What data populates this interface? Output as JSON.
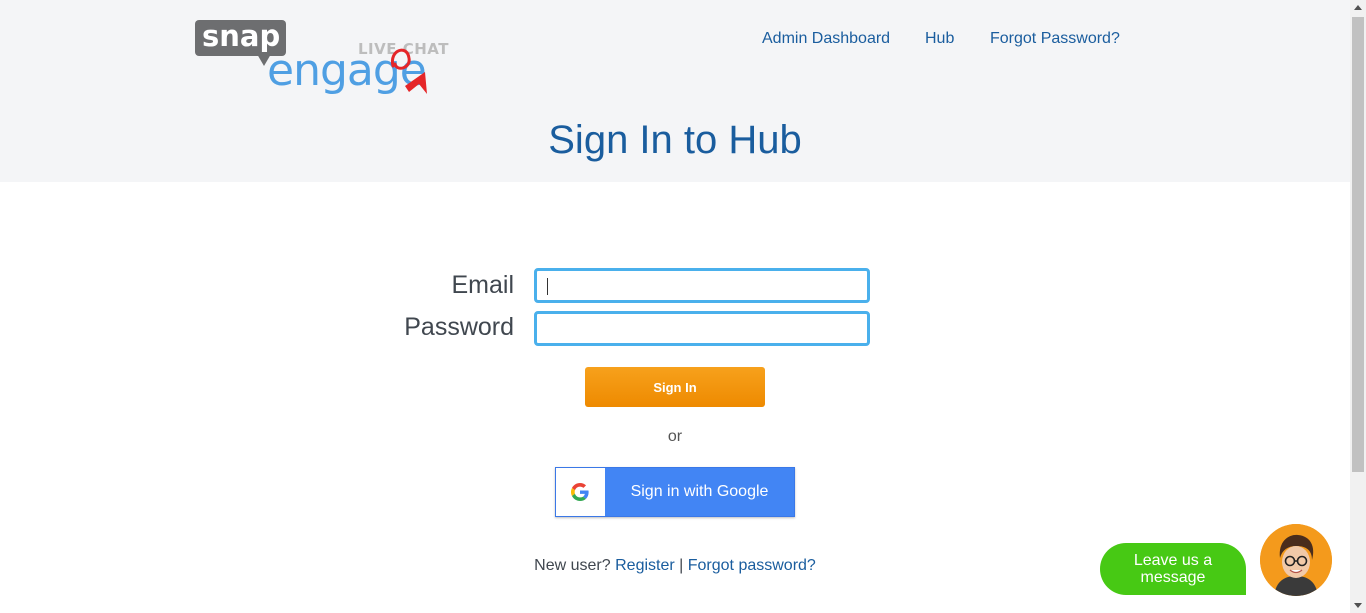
{
  "logo": {
    "snap": "snap",
    "engage": "engage",
    "livechat": "LIVE CHAT"
  },
  "nav": {
    "admin_dashboard": "Admin Dashboard",
    "hub": "Hub",
    "forgot_password": "Forgot Password?"
  },
  "page": {
    "title": "Sign In to Hub"
  },
  "form": {
    "email_label": "Email",
    "email_value": "",
    "password_label": "Password",
    "password_value": "",
    "signin_label": "Sign In",
    "or_text": "or",
    "google_label": "Sign in with Google"
  },
  "footer": {
    "new_user": "New user?",
    "register": "Register",
    "separator": "|",
    "forgot_password": "Forgot password?"
  },
  "chat": {
    "leave_message": "Leave us a message"
  },
  "colors": {
    "header_bg": "#f4f5f7",
    "link_blue": "#1a5d9e",
    "input_border": "#4ab0ec",
    "signin_orange": "#f29500",
    "google_blue": "#4285f4",
    "chat_green": "#47c914",
    "avatar_orange": "#f49a1c"
  },
  "icons": {
    "google": "google-g-icon",
    "avatar": "agent-avatar"
  }
}
